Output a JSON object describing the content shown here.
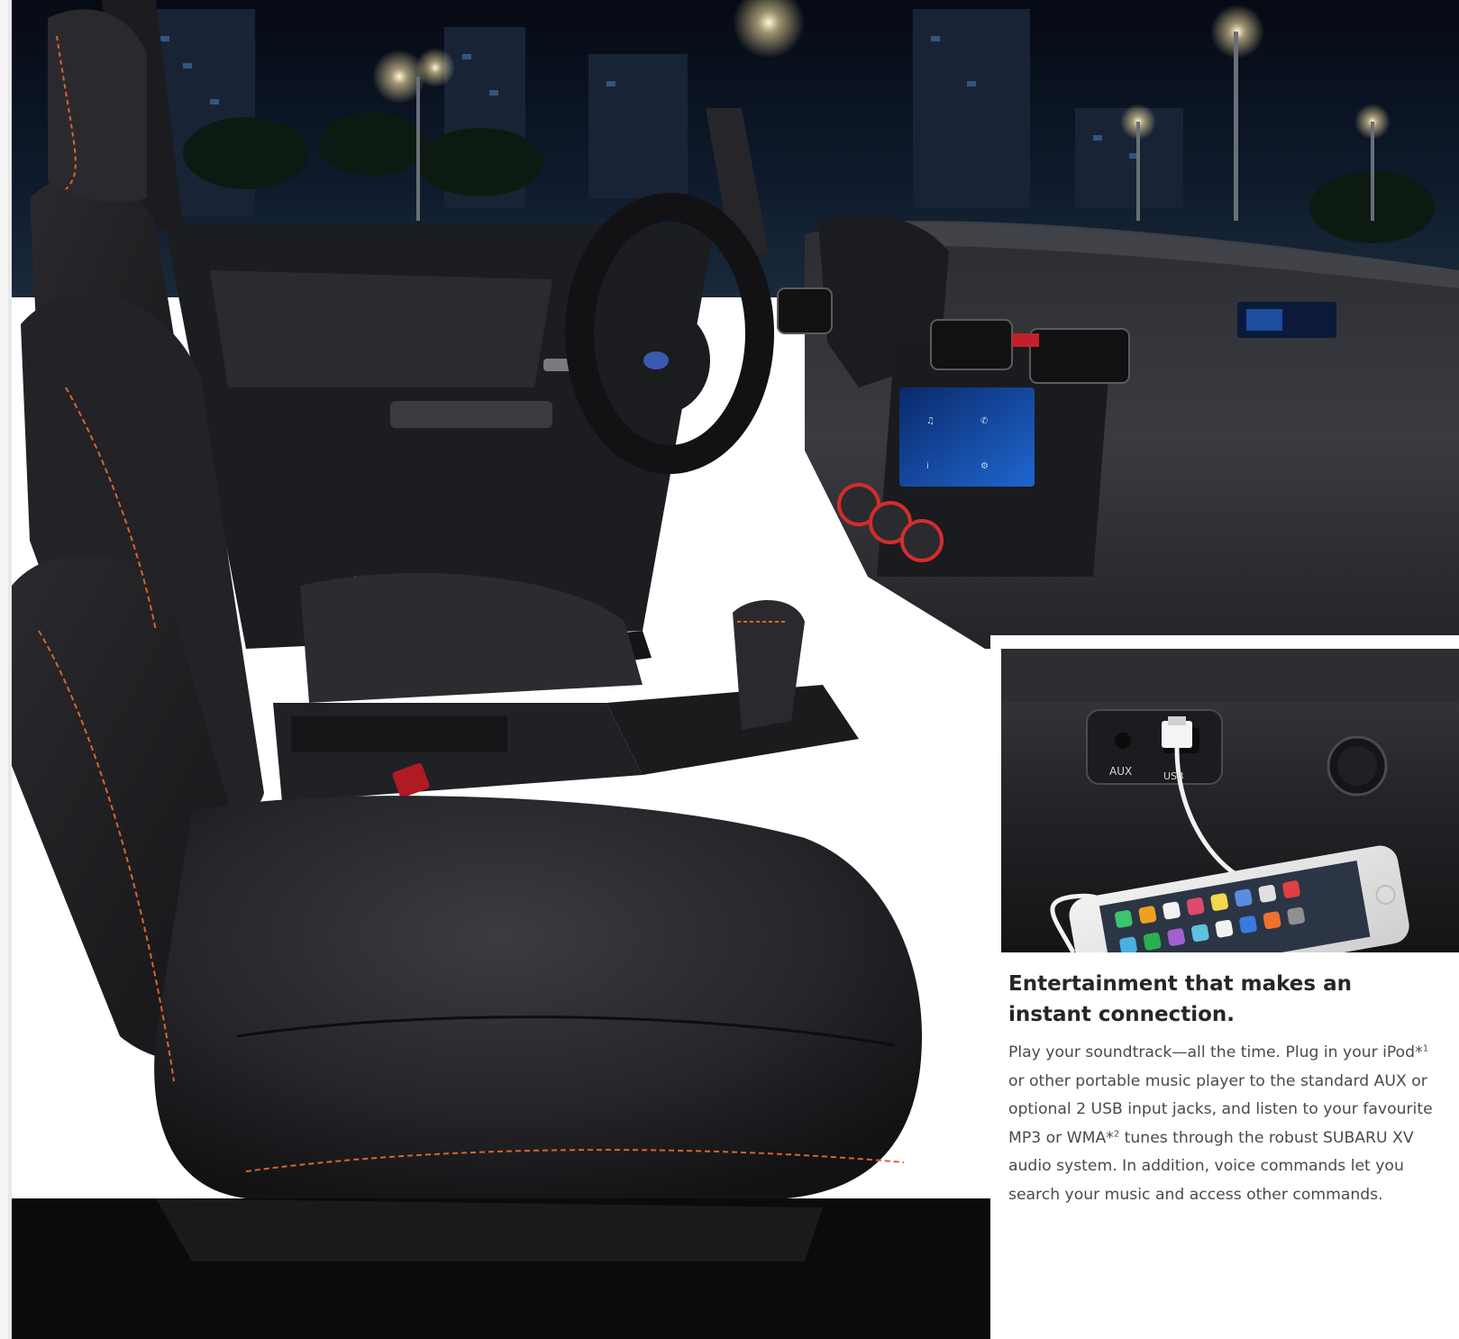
{
  "article": {
    "heading_line1": "Entertainment that makes an",
    "heading_line2": "instant connection.",
    "body": {
      "seg1": "Play your soundtrack—all the time. Plug in your iPod*",
      "sup1": "1",
      "seg2": " or other portable music player to the standard AUX or optional 2 USB input jacks, and listen to your favourite MP3 or WMA*",
      "sup2": "2",
      "seg3": " tunes through the robust SUBARU XV audio system. In addition, voice commands let you search your music and access other commands."
    }
  },
  "inset_photo": {
    "port_labels": {
      "aux": "AUX",
      "usb": "USB"
    }
  },
  "colors": {
    "stitching": "#d9642b",
    "night_sky": "#0c1422",
    "leather": "#1f1f22"
  }
}
